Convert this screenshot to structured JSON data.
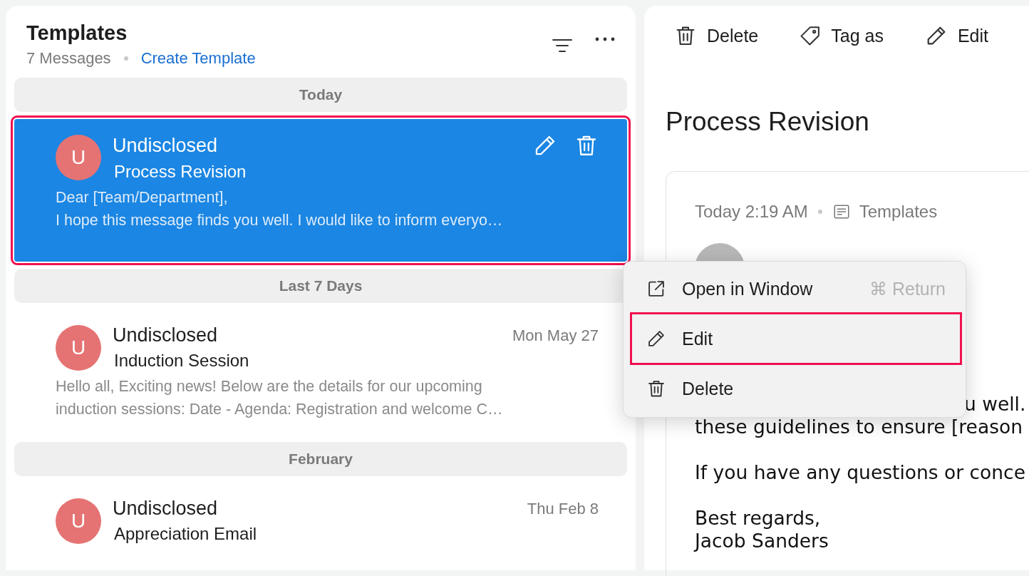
{
  "list": {
    "title": "Templates",
    "count": "7 Messages",
    "create_link": "Create Template",
    "groups": [
      {
        "label": "Today",
        "messages": [
          {
            "avatar": "U",
            "sender": "Undisclosed",
            "subject": "Process Revision",
            "preview": [
              "Dear [Team/Department],",
              "I hope this message finds you well. I would like to inform everyo…"
            ],
            "selected": true,
            "outlined": true
          }
        ]
      },
      {
        "label": "Last 7 Days",
        "messages": [
          {
            "avatar": "U",
            "sender": "Undisclosed",
            "subject": "Induction Session",
            "date": "Mon May 27",
            "preview": [
              "Hello all, Exciting news! Below are the details for our upcoming",
              "induction sessions: Date - Agenda: Registration and welcome C…"
            ],
            "selected": false,
            "outlined": false
          }
        ]
      },
      {
        "label": "February",
        "messages": [
          {
            "avatar": "U",
            "sender": "Undisclosed",
            "subject": "Appreciation Email",
            "date": "Thu Feb 8",
            "selected": false,
            "outlined": false
          }
        ]
      }
    ]
  },
  "toolbar": [
    {
      "kind": "trash",
      "label": "Delete"
    },
    {
      "kind": "tag",
      "label": "Tag as"
    },
    {
      "kind": "pencil",
      "label": "Edit"
    }
  ],
  "detail": {
    "title": "Process Revision",
    "time": "Today 2:19 AM",
    "folder": "Templates",
    "body": [
      {
        "kind": "tail",
        "text": "u well."
      },
      {
        "kind": "line",
        "text": "these guidelines to ensure [reason"
      },
      {
        "kind": "gap"
      },
      {
        "kind": "line",
        "text": "If you have any questions or conce"
      },
      {
        "kind": "gap"
      },
      {
        "kind": "line",
        "text": "Best regards,"
      },
      {
        "kind": "line",
        "text": "Jacob Sanders"
      }
    ]
  },
  "context_menu": [
    {
      "kind": "open",
      "label": "Open in Window",
      "shortcut": "⌘ Return",
      "outlined": false
    },
    {
      "kind": "pencil",
      "label": "Edit",
      "outlined": true
    },
    {
      "kind": "trash",
      "label": "Delete",
      "outlined": false
    }
  ]
}
